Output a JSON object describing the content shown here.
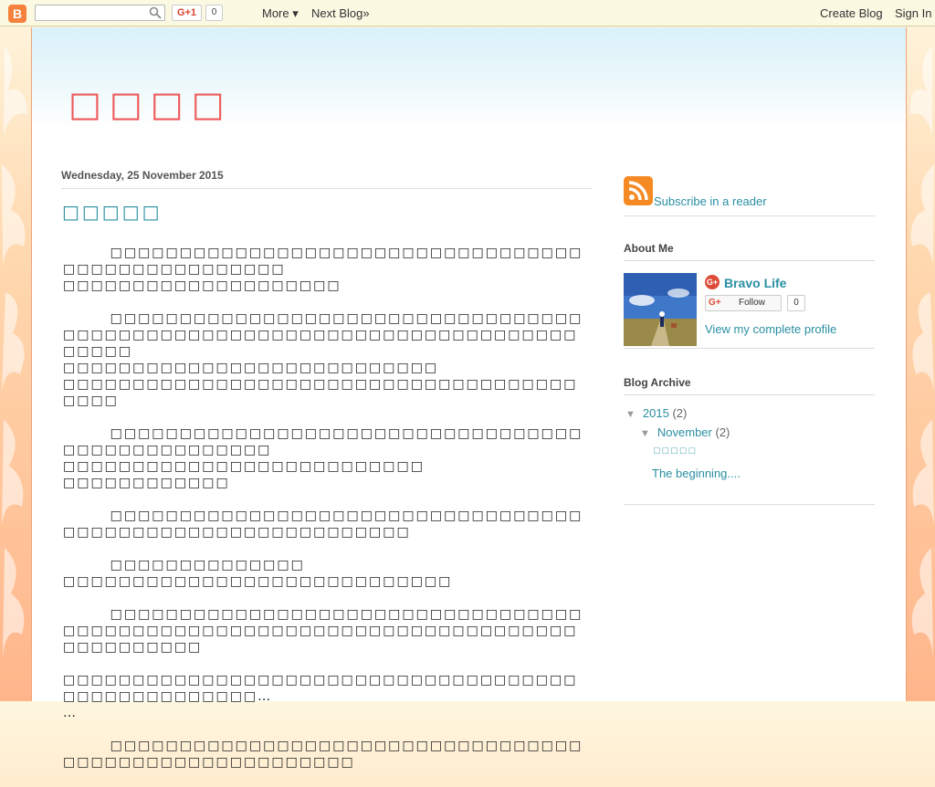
{
  "navbar": {
    "logo": "B",
    "search_placeholder": "",
    "gplus_label": "G+1",
    "gplus_count": "0",
    "more_label": "More ▾",
    "next_blog_label": "Next Blog»",
    "create_blog_label": "Create Blog",
    "sign_in_label": "Sign In"
  },
  "blog": {
    "title": "□□□□"
  },
  "post": {
    "date": "Wednesday, 25 November 2015",
    "title": "□□□□□",
    "paragraphs": [
      "        □□□□□□□□□□□□□□□□□□□□□□□□□□□□□□□□□□□□□□□□□□□□□□□□□□\n□□□□□□□□□□□□□□□□□□□□",
      "        □□□□□□□□□□□□□□□□□□□□□□□□□□□□□□□□□□□□□□□□□□□□□□□□□□□□□□□□□□□□□□□□□□□□□□□□□□□□\n□□□□□□□□□□□□□□□□□□□□□□□□□□□\n□□□□□□□□□□□□□□□□□□□□□□□□□□□□□□□□□□□□□□□□□",
      "        □□□□□□□□□□□□□□□□□□□□□□□□□□□□□□□□□□□□□□□□□□□□□□□□□\n□□□□□□□□□□□□□□□□□□□□□□□□□□\n□□□□□□□□□□□□",
      "        □□□□□□□□□□□□□□□□□□□□□□□□□□□□□□□□□□□□□□□□□□□□□□□□□□□□□□□□□□□",
      "        □□□□□□□□□□□□□□\n□□□□□□□□□□□□□□□□□□□□□□□□□□□□",
      "        □□□□□□□□□□□□□□□□□□□□□□□□□□□□□□□□□□□□□□□□□□□□□□□□□□□□□□□□□□□□□□□□□□□□□□□□□□□□□□□□□",
      "□□□□□□□□□□□□□□□□□□□□□□□□□□□□□□□□□□□□□□□□□□□□□□□□□□□…\n…",
      "        □□□□□□□□□□□□□□□□□□□□□□□□□□□□□□□□□□□□□□□□□□□□□□□□□□□□□□□"
    ]
  },
  "sidebar": {
    "subscribe_label": "Subscribe in a reader",
    "about": {
      "title": "About Me",
      "gplus_badge": "G+",
      "name": "Bravo Life",
      "follow_g": "G+",
      "follow_label": "Follow",
      "follow_count": "0",
      "profile_link": "View my complete profile"
    },
    "archive": {
      "title": "Blog Archive",
      "toggle": "▼",
      "year": "2015",
      "year_count": "(2)",
      "month": "November",
      "month_count": "(2)",
      "posts": [
        "□□□□□",
        "The beginning...."
      ]
    }
  },
  "colors": {
    "accent": "#2a8fa3",
    "title_red": "#ee5a5a",
    "rss_orange": "#f58a24"
  }
}
